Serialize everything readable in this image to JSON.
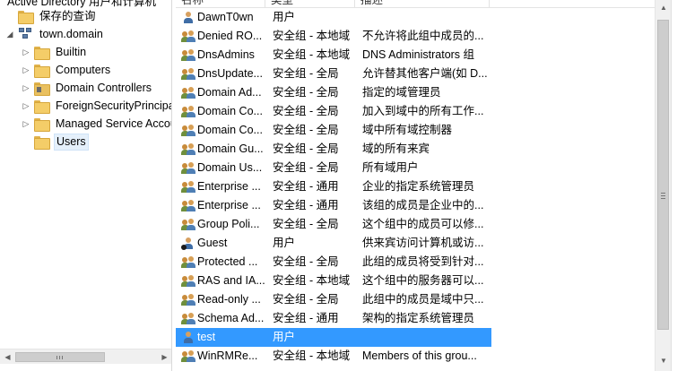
{
  "tree": {
    "root_label": "Active Directory 用户和计算机",
    "saved_queries": "保存的查询",
    "domain": "town.domain",
    "children": [
      "Builtin",
      "Computers",
      "Domain Controllers",
      "ForeignSecurityPrincipals",
      "Managed Service Accounts",
      "Users"
    ]
  },
  "list": {
    "headers": [
      "名称",
      "类型",
      "描述"
    ],
    "rows": [
      {
        "name": "DawnT0wn",
        "type": "用户",
        "desc": "",
        "icon": "user-icon"
      },
      {
        "name": "Denied RO...",
        "type": "安全组 - 本地域",
        "desc": "不允许将此组中成员的...",
        "icon": "group-icon"
      },
      {
        "name": "DnsAdmins",
        "type": "安全组 - 本地域",
        "desc": "DNS Administrators 组",
        "icon": "group-icon"
      },
      {
        "name": "DnsUpdate...",
        "type": "安全组 - 全局",
        "desc": "允许替其他客户端(如 D...",
        "icon": "group-icon"
      },
      {
        "name": "Domain Ad...",
        "type": "安全组 - 全局",
        "desc": "指定的域管理员",
        "icon": "group-icon"
      },
      {
        "name": "Domain Co...",
        "type": "安全组 - 全局",
        "desc": "加入到域中的所有工作...",
        "icon": "group-icon"
      },
      {
        "name": "Domain Co...",
        "type": "安全组 - 全局",
        "desc": "域中所有域控制器",
        "icon": "group-icon"
      },
      {
        "name": "Domain Gu...",
        "type": "安全组 - 全局",
        "desc": "域的所有来宾",
        "icon": "group-icon"
      },
      {
        "name": "Domain Us...",
        "type": "安全组 - 全局",
        "desc": "所有域用户",
        "icon": "group-icon"
      },
      {
        "name": "Enterprise ...",
        "type": "安全组 - 通用",
        "desc": "企业的指定系统管理员",
        "icon": "group-icon"
      },
      {
        "name": "Enterprise ...",
        "type": "安全组 - 通用",
        "desc": "该组的成员是企业中的...",
        "icon": "group-icon"
      },
      {
        "name": "Group Poli...",
        "type": "安全组 - 全局",
        "desc": "这个组中的成员可以修...",
        "icon": "group-icon"
      },
      {
        "name": "Guest",
        "type": "用户",
        "desc": "供来宾访问计算机或访...",
        "icon": "disabled-user-icon"
      },
      {
        "name": "Protected ...",
        "type": "安全组 - 全局",
        "desc": "此组的成员将受到针对...",
        "icon": "group-icon"
      },
      {
        "name": "RAS and IA...",
        "type": "安全组 - 本地域",
        "desc": "这个组中的服务器可以...",
        "icon": "group-icon"
      },
      {
        "name": "Read-only ...",
        "type": "安全组 - 全局",
        "desc": "此组中的成员是域中只...",
        "icon": "group-icon"
      },
      {
        "name": "Schema Ad...",
        "type": "安全组 - 通用",
        "desc": "架构的指定系统管理员",
        "icon": "group-icon"
      },
      {
        "name": "test",
        "type": "用户",
        "desc": "",
        "icon": "user-icon"
      },
      {
        "name": "WinRMRe...",
        "type": "安全组 - 本地域",
        "desc": "Members of this grou...",
        "icon": "group-icon"
      }
    ],
    "selected_index": 17
  },
  "colors": {
    "selection": "#3399ff",
    "tree_selection": "#e5f0fb",
    "folder": "#f4cd68"
  }
}
